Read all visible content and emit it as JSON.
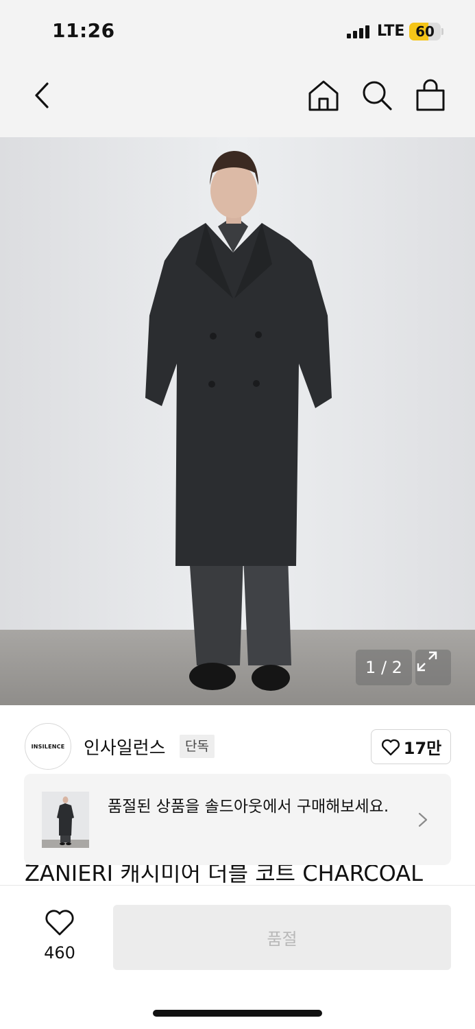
{
  "status_bar": {
    "time": "11:26",
    "network": "LTE",
    "battery": "60",
    "battery_level": 0.6,
    "battery_color": "#f5c518"
  },
  "nav": {
    "back_icon": "chevron-left-icon",
    "home_icon": "home-icon",
    "search_icon": "search-icon",
    "cart_icon": "shopping-bag-icon"
  },
  "gallery": {
    "page_indicator": "1 / 2",
    "expand_icon": "expand-icon"
  },
  "brand": {
    "logo_text": "INSILENCE",
    "name": "인사일런스",
    "badge": "단독",
    "likes": "17만"
  },
  "soldout_banner": {
    "text": "품절된 상품을 솔드아웃에서 구매해보세요.",
    "chevron_icon": "chevron-right-icon"
  },
  "product": {
    "title": "ZANIERI 캐시미어 더블 코트 CHARCOAL"
  },
  "bottom_bar": {
    "wish_count": "460",
    "purchase_label": "품절",
    "purchase_bg": "#ececec"
  }
}
